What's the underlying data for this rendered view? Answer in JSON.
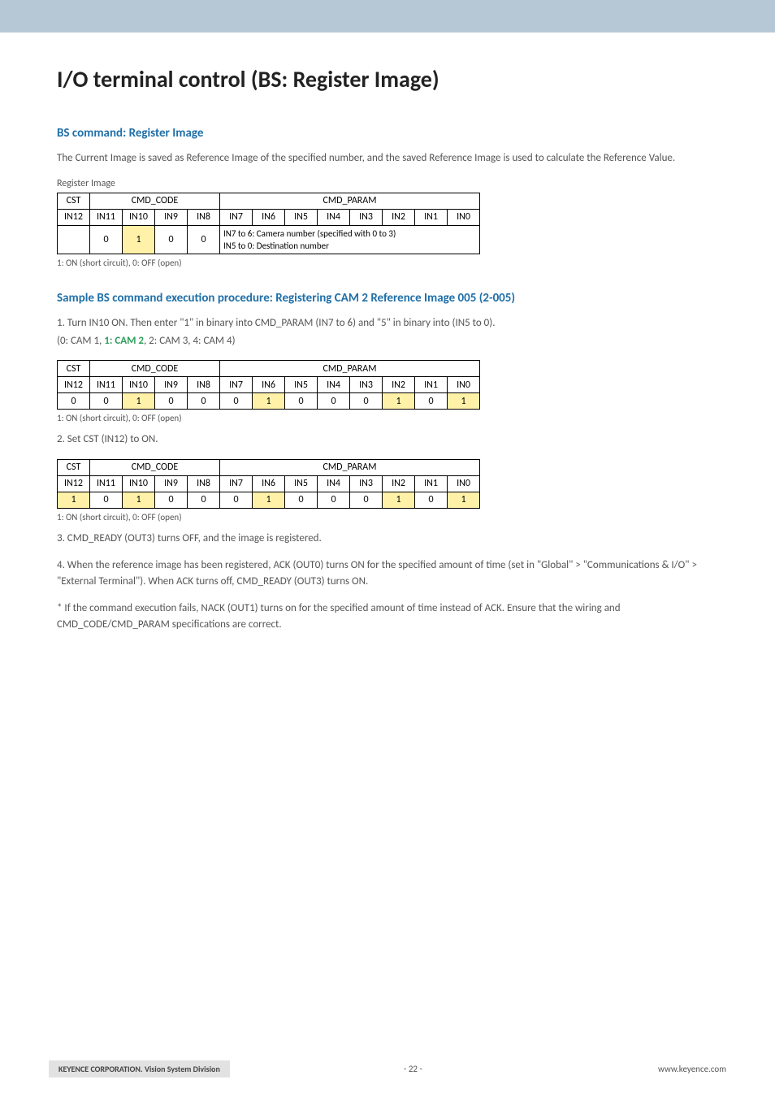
{
  "page_title": "I/O terminal control (BS: Register Image)",
  "section1": {
    "heading": "BS command: Register Image",
    "desc": "The Current Image is saved as Reference Image of the specified number, and the saved Reference Image is used to calculate the Reference Value.",
    "table_caption": "Register Image",
    "note": "1: ON (short circuit), 0: OFF (open)"
  },
  "headers": {
    "cst": "CST",
    "cmd_code": "CMD_CODE",
    "cmd_param": "CMD_PARAM",
    "in12": "IN12",
    "in11": "IN11",
    "in10": "IN10",
    "in9": "IN9",
    "in8": "IN8",
    "in7": "IN7",
    "in6": "IN6",
    "in5": "IN5",
    "in4": "IN4",
    "in3": "IN3",
    "in2": "IN2",
    "in1": "IN1",
    "in0": "IN0"
  },
  "table1": {
    "in12": "",
    "in11": "0",
    "in10": "1",
    "in9": "0",
    "in8": "0",
    "param_desc_l1": "IN7 to 6: Camera number (specified with 0 to 3)",
    "param_desc_l2": "IN5 to 0: Destination number"
  },
  "section2": {
    "heading": "Sample BS command execution procedure: Registering CAM 2 Reference Image 005 (2-005)",
    "step1_a": "1. Turn IN10 ON. Then enter \"1\" in binary into CMD_PARAM (IN7 to 6) and \"5\" in binary into (IN5 to 0).",
    "step1_b_pre": "(0: CAM 1, ",
    "step1_b_hl": "1: CAM 2",
    "step1_b_post": ", 2: CAM 3, 4: CAM 4)",
    "note": "1: ON (short circuit), 0: OFF (open)",
    "step2": "2. Set CST (IN12) to ON.",
    "step3": "3. CMD_READY (OUT3) turns OFF, and the image is registered.",
    "step4": "4. When the reference image has been registered, ACK (OUT0) turns ON for the specified amount of time (set in \"Global\" > \"Communications & I/O\" > \"External Terminal\"). When ACK turns off, CMD_READY (OUT3) turns ON.",
    "note2": "* If the command execution fails, NACK (OUT1) turns on for the specified amount of time instead of ACK. Ensure that the wiring and CMD_CODE/CMD_PARAM specifications are correct."
  },
  "table2": {
    "row": {
      "in12": "0",
      "in11": "0",
      "in10": "1",
      "in9": "0",
      "in8": "0",
      "in7": "0",
      "in6": "1",
      "in5": "0",
      "in4": "0",
      "in3": "0",
      "in2": "1",
      "in1": "0",
      "in0": "1"
    },
    "hl": [
      "in10",
      "in6",
      "in2",
      "in0"
    ]
  },
  "table3": {
    "row": {
      "in12": "1",
      "in11": "0",
      "in10": "1",
      "in9": "0",
      "in8": "0",
      "in7": "0",
      "in6": "1",
      "in5": "0",
      "in4": "0",
      "in3": "0",
      "in2": "1",
      "in1": "0",
      "in0": "1"
    },
    "hl": [
      "in12",
      "in10",
      "in6",
      "in2",
      "in0"
    ]
  },
  "footer": {
    "left": "KEYENCE CORPORATION. Vision System Division",
    "center": "- 22 -",
    "right": "www.keyence.com"
  },
  "chart_data": [
    {
      "type": "table",
      "title": "Register Image — CMD_CODE / CMD_PARAM bit map",
      "columns": [
        "CST",
        "IN12",
        "IN11",
        "IN10",
        "IN9",
        "IN8",
        "IN7",
        "IN6",
        "IN5",
        "IN4",
        "IN3",
        "IN2",
        "IN1",
        "IN0"
      ],
      "rows": [
        {
          "CST": "",
          "IN11": 0,
          "IN10": 1,
          "IN9": 0,
          "IN8": 0,
          "CMD_PARAM": "IN7 to 6: Camera number (specified with 0 to 3); IN5 to 0: Destination number"
        }
      ]
    },
    {
      "type": "table",
      "title": "Step 1 — enter CAM 2, destination 005",
      "columns": [
        "IN12",
        "IN11",
        "IN10",
        "IN9",
        "IN8",
        "IN7",
        "IN6",
        "IN5",
        "IN4",
        "IN3",
        "IN2",
        "IN1",
        "IN0"
      ],
      "rows": [
        {
          "IN12": 0,
          "IN11": 0,
          "IN10": 1,
          "IN9": 0,
          "IN8": 0,
          "IN7": 0,
          "IN6": 1,
          "IN5": 0,
          "IN4": 0,
          "IN3": 0,
          "IN2": 1,
          "IN1": 0,
          "IN0": 1
        }
      ],
      "highlighted": [
        "IN10",
        "IN6",
        "IN2",
        "IN0"
      ]
    },
    {
      "type": "table",
      "title": "Step 2 — CST (IN12) ON",
      "columns": [
        "IN12",
        "IN11",
        "IN10",
        "IN9",
        "IN8",
        "IN7",
        "IN6",
        "IN5",
        "IN4",
        "IN3",
        "IN2",
        "IN1",
        "IN0"
      ],
      "rows": [
        {
          "IN12": 1,
          "IN11": 0,
          "IN10": 1,
          "IN9": 0,
          "IN8": 0,
          "IN7": 0,
          "IN6": 1,
          "IN5": 0,
          "IN4": 0,
          "IN3": 0,
          "IN2": 1,
          "IN1": 0,
          "IN0": 1
        }
      ],
      "highlighted": [
        "IN12",
        "IN10",
        "IN6",
        "IN2",
        "IN0"
      ]
    }
  ]
}
